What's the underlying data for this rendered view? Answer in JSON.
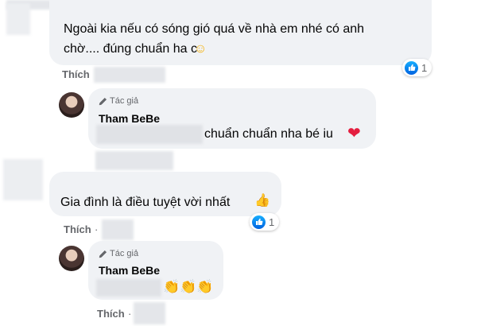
{
  "comments": [
    {
      "text_line1": "Ngoài kia nếu có sóng gió quá về nhà em nhé có anh",
      "text_line2": "chờ.... đúng chuẩn ha c",
      "emoji": "☺",
      "reaction_count": "1",
      "like_label": "Thích"
    },
    {
      "text": "Gia đình là điều tuyệt vời nhất",
      "emoji": "👍",
      "reaction_count": "1",
      "like_label": "Thích",
      "separator": "·"
    }
  ],
  "replies": [
    {
      "author_badge": "Tác giả",
      "author_name": "Tham BeBe",
      "text": "chuẩn chuẩn nha bé iu",
      "emoji": "❤"
    },
    {
      "author_badge": "Tác giả",
      "author_name": "Tham BeBe",
      "emoji": "👏👏👏",
      "like_label": "Thích",
      "separator": "·"
    }
  ],
  "colors": {
    "bubble": "#f0f2f5",
    "like_blue": "#1877f2",
    "heart_red": "#e41e3f",
    "secondary_text": "#65676b"
  }
}
